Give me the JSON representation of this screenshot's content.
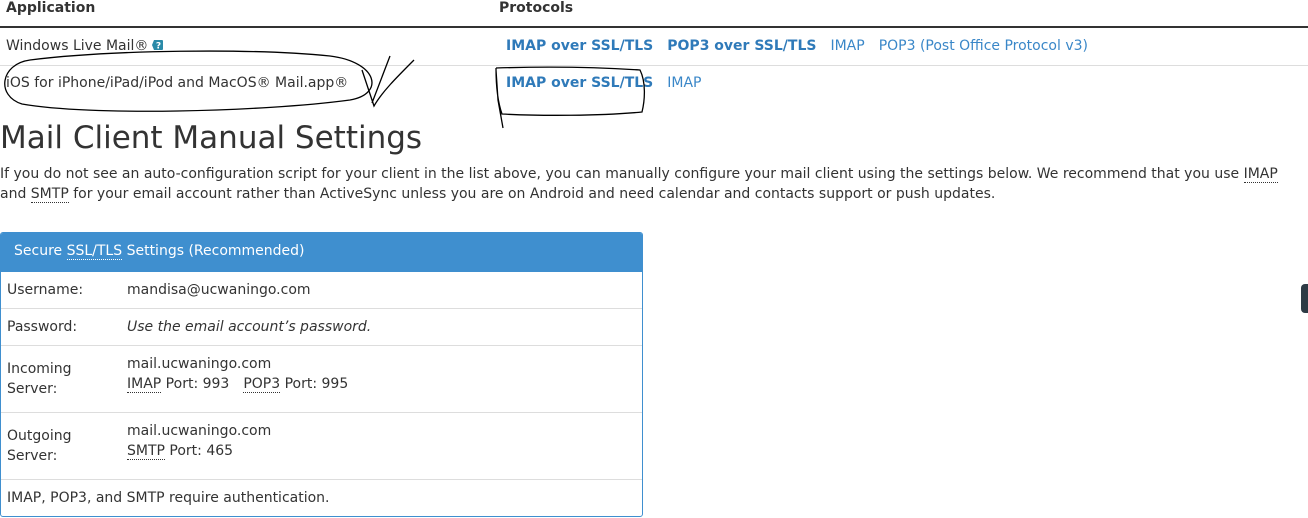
{
  "protocols_table": {
    "header_application": "Application",
    "header_protocols": "Protocols",
    "rows": [
      {
        "app": "Windows Live Mail®",
        "links": [
          {
            "label": "IMAP over SSL/TLS",
            "bold": true
          },
          {
            "label": "POP3 over SSL/TLS",
            "bold": true
          },
          {
            "label": "IMAP",
            "bold": false
          },
          {
            "label": "POP3 (Post Office Protocol v3)",
            "bold": false
          }
        ]
      },
      {
        "app": "iOS for iPhone/iPad/iPod and MacOS® Mail.app®",
        "links": [
          {
            "label": "IMAP over SSL/TLS",
            "bold": true
          },
          {
            "label": "IMAP",
            "bold": false
          }
        ]
      }
    ]
  },
  "manual": {
    "title": "Mail Client Manual Settings",
    "intro_part1": "If you do not see an auto-configuration script for your client in the list above, you can manually configure your mail client using the settings below. We recommend that you use ",
    "intro_imap": "IMAP",
    "intro_and": " and ",
    "intro_smtp": "SMTP",
    "intro_part2": " for your email account rather than ActiveSync unless you are on Android and need calendar and contacts support or push updates."
  },
  "panel": {
    "title_prefix": "Secure ",
    "title_abbr": "SSL/TLS",
    "title_suffix": " Settings (Recommended)",
    "username_label": "Username:",
    "username_value": "mandisa@ucwaningo.com",
    "password_label": "Password:",
    "password_value": "Use the email account’s password.",
    "incoming_label": "Incoming Server:",
    "incoming_host": "mail.ucwaningo.com",
    "imap_abbr": "IMAP",
    "imap_port": " Port: 993",
    "pop3_abbr": "POP3",
    "pop3_port": " Port: 995",
    "outgoing_label": "Outgoing Server:",
    "outgoing_host": "mail.ucwaningo.com",
    "smtp_abbr": "SMTP",
    "smtp_port": " Port: 465",
    "auth_note": "IMAP, POP3, and SMTP require authentication."
  },
  "colors": {
    "link": "#3a87c8",
    "panel_header": "#3f8fcf",
    "help_icon": "#2a8aa8"
  },
  "icons": {
    "help": "help-icon"
  }
}
